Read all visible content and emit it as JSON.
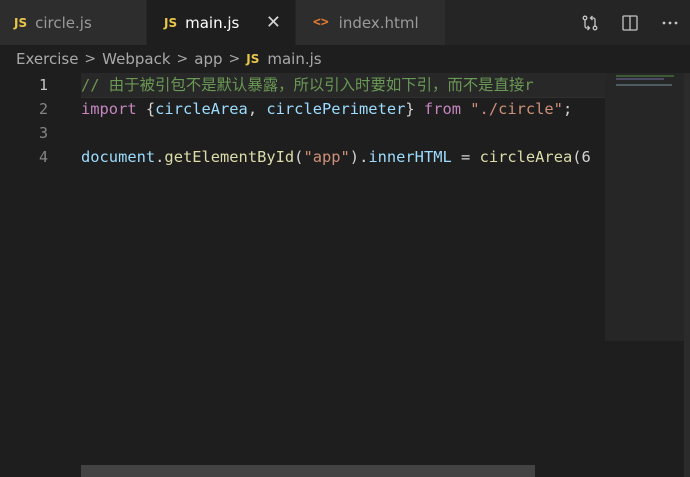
{
  "tabs": [
    {
      "icon": "JS",
      "label": "circle.js",
      "active": false
    },
    {
      "icon": "JS",
      "label": "main.js",
      "active": true,
      "close": "✕"
    },
    {
      "icon": "<>",
      "label": "index.html",
      "active": false
    }
  ],
  "breadcrumb": {
    "items": [
      "Exercise",
      "Webpack",
      "app"
    ],
    "separator": ">",
    "file_icon": "JS",
    "file": "main.js"
  },
  "actions": [
    "compare-changes-icon",
    "split-editor-icon",
    "more-actions-icon"
  ],
  "gutter": [
    "1",
    "2",
    "3",
    "4"
  ],
  "code": {
    "line1_comment": "// 由于被引包不是默认暴露，所以引入时要如下引，而不是直接r",
    "line2": {
      "kw_import": "import",
      "brace_open": " {",
      "var1": "circleArea",
      "comma": ", ",
      "var2": "circlePerimeter",
      "brace_close": "} ",
      "kw_from": "from",
      "space": " ",
      "str": "\"./circle\"",
      "semi": ";"
    },
    "line4": {
      "obj": "document",
      "dot1": ".",
      "fn1": "getElementById",
      "p_open": "(",
      "str": "\"app\"",
      "p_close": ")",
      "dot2": ".",
      "prop": "innerHTML",
      "eq": " = ",
      "fn2": "circleArea",
      "rest": "(6"
    }
  },
  "colors": {
    "js_icon": "#e8c54b",
    "html_icon": "#e37933",
    "comment": "#6a9955",
    "keyword": "#c586c0",
    "variable": "#9cdcfe",
    "function": "#dcdcaa",
    "string": "#ce9178"
  }
}
